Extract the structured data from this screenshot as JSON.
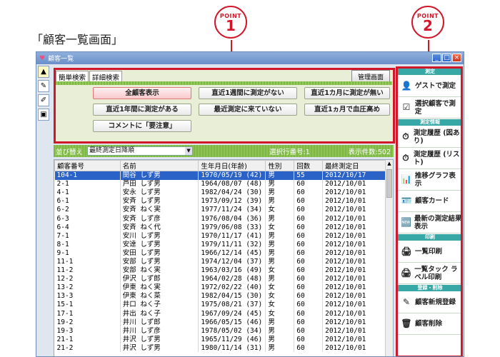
{
  "caption": "「顧客一覧画面」",
  "points": [
    {
      "label": "POINT",
      "num": "1"
    },
    {
      "label": "POINT",
      "num": "2"
    }
  ],
  "window": {
    "title": "顧客一覧",
    "btn_min": "_",
    "btn_max": "□",
    "btn_close": "×"
  },
  "tools": [
    "▲",
    "✎",
    "✐",
    "▣"
  ],
  "search": {
    "tabs": [
      "簡単検索",
      "詳細検索"
    ],
    "mgmt_button": "管理画面",
    "filters": [
      "全顧客表示",
      "直近1週間に測定がない",
      "直近1カ月に測定が無い",
      "直近1年間に測定がある",
      "最近測定に来ていない",
      "直近1ヵ月で血圧高め",
      "コメントに「要注意」"
    ]
  },
  "sortbar": {
    "label": "並び替え",
    "value": "最終測定日降順",
    "arrow": "▼",
    "selected_no": "選択行番号:1",
    "count": "表示件数:502"
  },
  "table": {
    "headers": [
      "顧客番号",
      "名前",
      "生年月日(年齢)",
      "性別",
      "回数",
      "最終測定日"
    ],
    "rows": [
      [
        "104-1",
        "関谷 しず男",
        "1970/05/19 (42)",
        "男",
        "55",
        "2012/10/17"
      ],
      [
        "2-1",
        "芦田 しず男",
        "1964/08/07 (48)",
        "男",
        "60",
        "2012/10/01"
      ],
      [
        "4-1",
        "安永 しず男",
        "1982/04/24 (30)",
        "男",
        "60",
        "2012/10/01"
      ],
      [
        "6-1",
        "安斉 しず男",
        "1973/09/12 (39)",
        "男",
        "60",
        "2012/10/01"
      ],
      [
        "6-2",
        "安斉 ねく実",
        "1977/11/24 (34)",
        "女",
        "60",
        "2012/10/01"
      ],
      [
        "6-3",
        "安斉 しず彦",
        "1976/08/04 (36)",
        "男",
        "60",
        "2012/10/01"
      ],
      [
        "6-4",
        "安斉 ねく代",
        "1979/06/08 (33)",
        "女",
        "60",
        "2012/10/01"
      ],
      [
        "7-1",
        "安川 しず男",
        "1970/11/17 (41)",
        "男",
        "60",
        "2012/10/01"
      ],
      [
        "8-1",
        "安達 しず男",
        "1979/11/11 (32)",
        "男",
        "60",
        "2012/10/01"
      ],
      [
        "9-1",
        "安田 しず男",
        "1966/12/14 (45)",
        "男",
        "60",
        "2012/10/01"
      ],
      [
        "11-1",
        "安部 しず男",
        "1974/12/04 (37)",
        "男",
        "60",
        "2012/10/01"
      ],
      [
        "11-2",
        "安部 ねく実",
        "1963/03/16 (49)",
        "女",
        "60",
        "2012/10/01"
      ],
      [
        "12-2",
        "伊沢 しず郎",
        "1964/02/28 (48)",
        "男",
        "60",
        "2012/10/01"
      ],
      [
        "13-2",
        "伊東 ねく実",
        "1972/02/22 (40)",
        "女",
        "60",
        "2012/10/01"
      ],
      [
        "13-3",
        "伊東 ねく菜",
        "1982/04/15 (30)",
        "女",
        "60",
        "2012/10/01"
      ],
      [
        "15-1",
        "井口 ねく子",
        "1975/08/21 (37)",
        "女",
        "60",
        "2012/10/01"
      ],
      [
        "17-1",
        "井出 ねく子",
        "1967/09/24 (45)",
        "女",
        "60",
        "2012/10/01"
      ],
      [
        "19-2",
        "井川 しず郎",
        "1966/05/15 (46)",
        "男",
        "60",
        "2012/10/01"
      ],
      [
        "19-3",
        "井川 しず彦",
        "1978/05/02 (34)",
        "男",
        "60",
        "2012/10/01"
      ],
      [
        "21-1",
        "井沢 しず男",
        "1965/11/29 (46)",
        "男",
        "60",
        "2012/10/01"
      ],
      [
        "21-2",
        "井沢 しず男",
        "1980/11/14 (31)",
        "男",
        "60",
        "2012/10/01"
      ]
    ],
    "scroll_up": "▲",
    "scroll_down": "▼"
  },
  "side": {
    "sections": [
      {
        "head": "測定",
        "items": [
          {
            "icon": "👤",
            "icon_name": "guest-measure-icon",
            "label": "ゲストで測定"
          },
          {
            "icon": "☑",
            "icon_name": "check-icon",
            "label": "選択顧客で測定"
          }
        ]
      },
      {
        "head": "測定情報",
        "items": [
          {
            "icon": "⏱",
            "icon_name": "history-chart-icon",
            "label": "測定履歴 (図あり)"
          },
          {
            "icon": "⏱",
            "icon_name": "history-list-icon",
            "label": "測定履歴 (リスト)"
          },
          {
            "icon": "📊",
            "icon_name": "trend-graph-icon",
            "label": "推移グラフ表示"
          },
          {
            "icon": "🪪",
            "icon_name": "customer-card-icon",
            "label": "顧客カード"
          },
          {
            "icon": "🆕",
            "icon_name": "latest-result-icon",
            "label": "最新の測定結果表示"
          }
        ]
      },
      {
        "head": "印刷",
        "items": [
          {
            "icon": "🖨",
            "icon_name": "printer-icon",
            "label": "一覧印刷"
          },
          {
            "icon": "🖨",
            "icon_name": "label-print-icon",
            "label": "一覧タック ラベル印刷"
          }
        ]
      },
      {
        "head": "登録・削除",
        "items": [
          {
            "icon": "✎",
            "icon_name": "pencil-icon",
            "label": "顧客新規登録"
          },
          {
            "icon": "🗑",
            "icon_name": "trash-icon",
            "label": "顧客削除"
          }
        ]
      }
    ]
  },
  "colors": {
    "accent_red": "#d0182a",
    "green_bar": "#7cb842",
    "selected_row": "#2a62c8"
  }
}
